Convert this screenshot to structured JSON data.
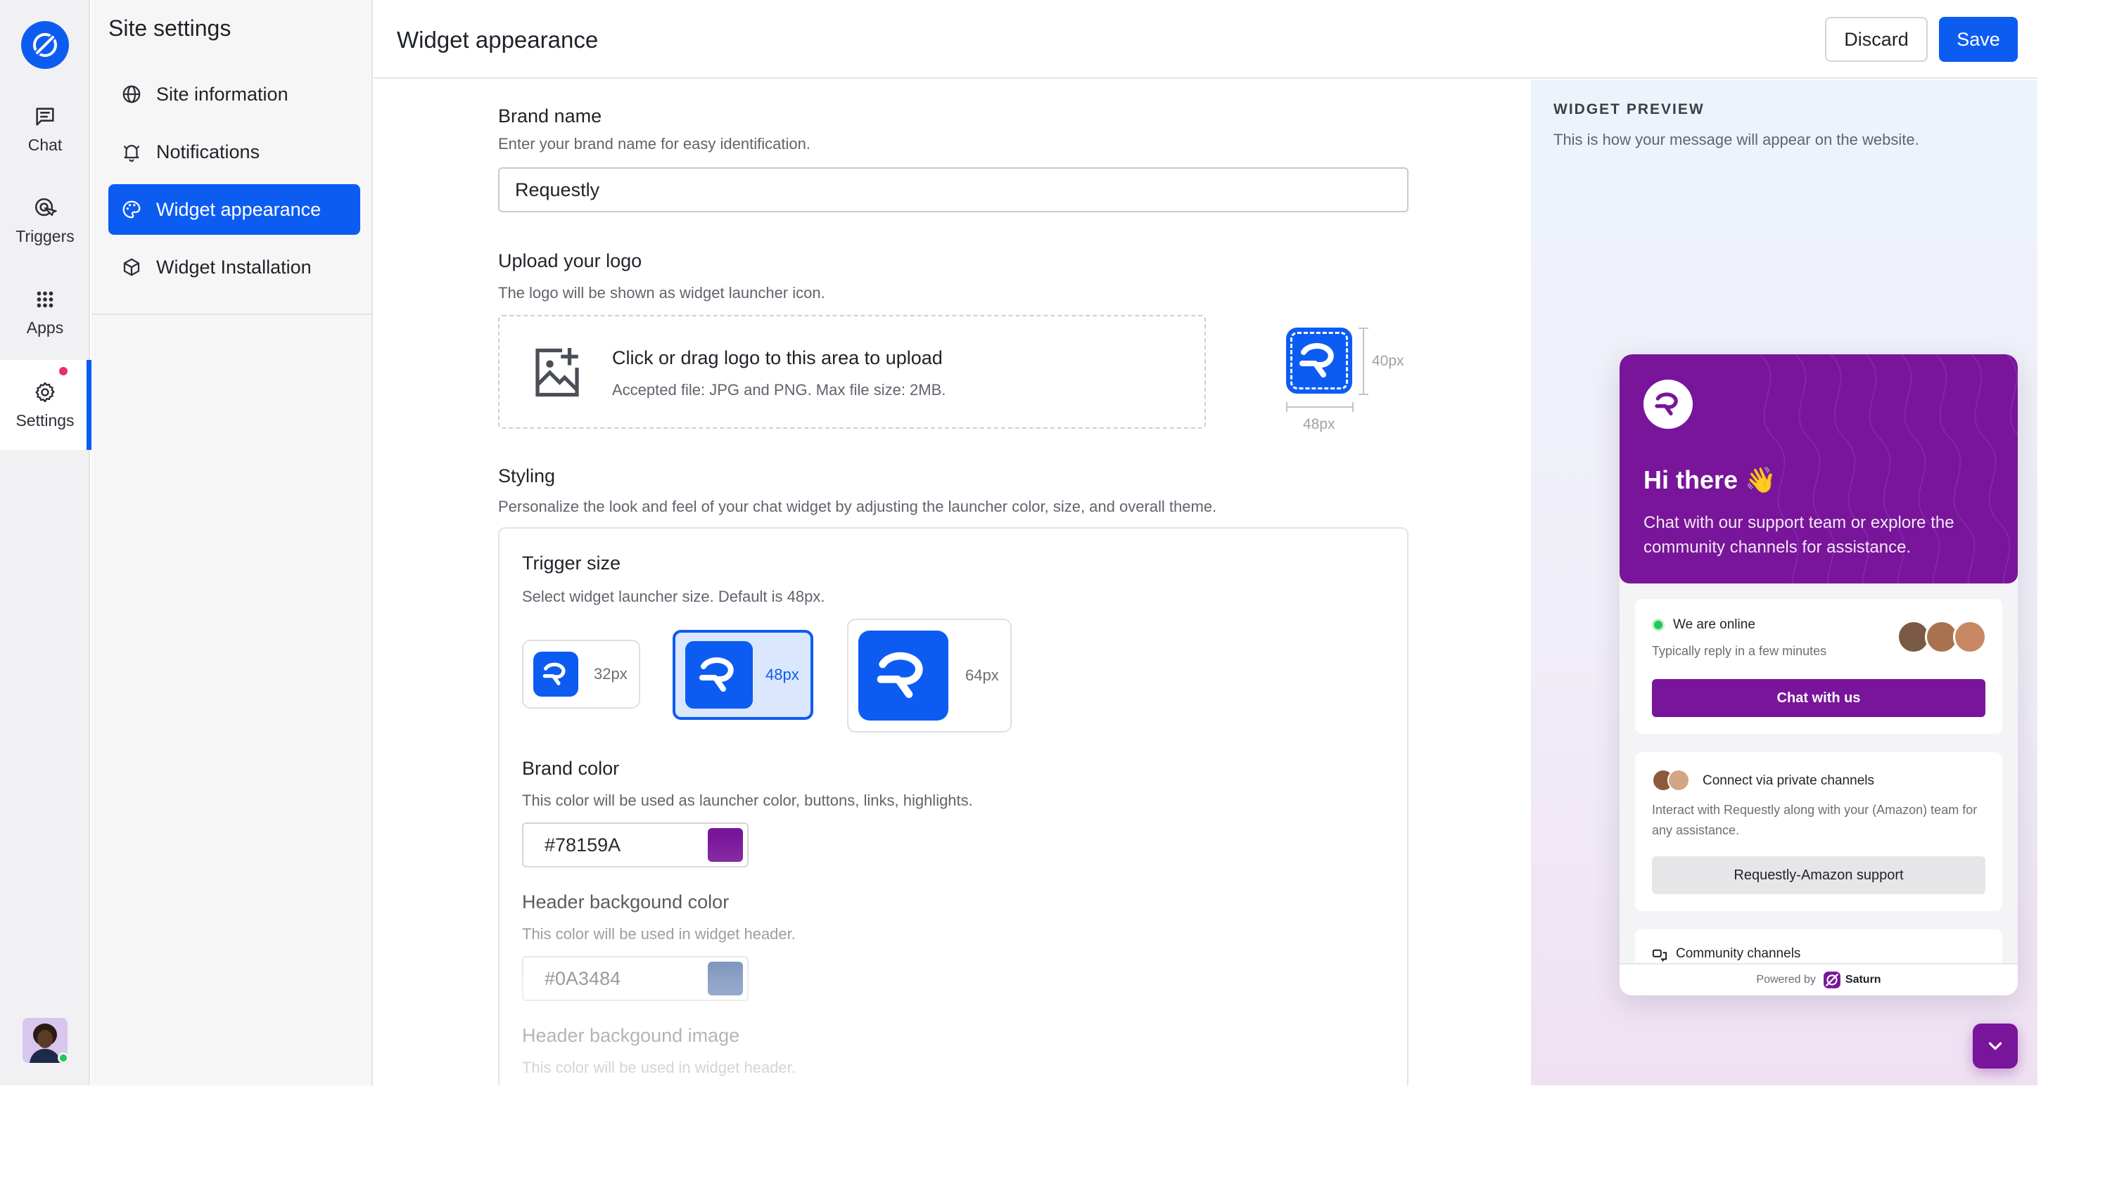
{
  "rail": {
    "items": [
      {
        "label": "Chat",
        "icon": "chat-icon"
      },
      {
        "label": "Triggers",
        "icon": "triggers-icon"
      },
      {
        "label": "Apps",
        "icon": "apps-grid-icon"
      },
      {
        "label": "Settings",
        "icon": "gear-icon",
        "active": true,
        "has_notification_dot": true
      }
    ],
    "user_status": "online"
  },
  "subnav": {
    "title": "Site settings",
    "items": [
      {
        "label": "Site information",
        "icon": "globe-icon"
      },
      {
        "label": "Notifications",
        "icon": "bell-icon"
      },
      {
        "label": "Widget appearance",
        "icon": "palette-icon",
        "active": true
      },
      {
        "label": "Widget Installation",
        "icon": "cube-icon"
      }
    ]
  },
  "header": {
    "title": "Widget appearance",
    "discard_label": "Discard",
    "save_label": "Save"
  },
  "form": {
    "brand_name": {
      "label": "Brand name",
      "help": "Enter your brand name for easy identification.",
      "value": "Requestly"
    },
    "logo": {
      "label": "Upload your logo",
      "help": "The logo will be shown as widget launcher icon.",
      "upload_title": "Click or drag logo to this area to upload",
      "upload_hint": "Accepted file: JPG and PNG. Max file size: 2MB.",
      "height_label": "40px",
      "width_label": "48px"
    },
    "styling": {
      "label": "Styling",
      "help": "Personalize the look and feel of your chat widget by adjusting the launcher color, size, and overall theme.",
      "trigger_size": {
        "label": "Trigger size",
        "help": "Select widget launcher size. Default is 48px.",
        "options": [
          "32px",
          "48px",
          "64px"
        ],
        "selected": "48px"
      },
      "brand_color": {
        "label": "Brand color",
        "help": "This color will be used as launcher color, buttons, links, highlights.",
        "value": "#78159A"
      },
      "header_bg_color": {
        "label": "Header backgound color",
        "help": "This color will be used in widget header.",
        "value": "#0A3484"
      },
      "header_bg_image": {
        "label": "Header backgound image",
        "help": "This color will be used in widget header."
      }
    }
  },
  "preview": {
    "title": "WIDGET PREVIEW",
    "subtitle": "This is how your message will appear on the website.",
    "widget": {
      "greeting": "Hi there 👋",
      "description": "Chat with our support team or explore the community channels for assistance.",
      "online_status": "We are online",
      "reply_time": "Typically reply in a few minutes",
      "chat_button": "Chat with us",
      "private_title": "Connect via private channels",
      "private_desc": "Interact with Requestly along with your (Amazon) team for any assistance.",
      "private_button": "Requestly-Amazon support",
      "community_title": "Community channels",
      "powered_by": "Powered by",
      "powered_brand": "Saturn"
    }
  },
  "colors": {
    "primary": "#0D5CF2",
    "brand": "#78159A",
    "header_bg": "#0A3484",
    "notification": "#E5306B",
    "online": "#22C55E"
  }
}
